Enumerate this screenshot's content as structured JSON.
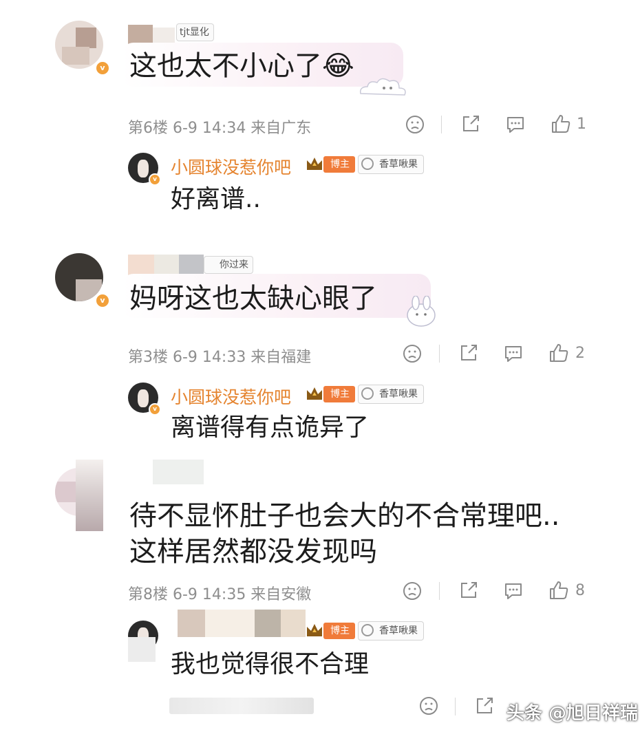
{
  "comments": [
    {
      "fan_badge": "tjt显化",
      "text": "这也太不小心了😂",
      "meta": "第6楼 6-9 14:34 来自广东",
      "likes": "1",
      "reply": {
        "name": "小圆球没惹你吧",
        "role": "博主",
        "tag": "香草啾果",
        "text": "好离谱.."
      }
    },
    {
      "fan_badge": "你过来",
      "text": "妈呀这也太缺心眼了",
      "meta": "第3楼 6-9 14:33 来自福建",
      "likes": "2",
      "reply": {
        "name": "小圆球没惹你吧",
        "role": "博主",
        "tag": "香草啾果",
        "text": "离谱得有点诡异了"
      }
    },
    {
      "text_line1": "待不显怀肚子也会大的不合常理吧..",
      "text_line2": "这样居然都没发现吗",
      "meta": "第8楼 6-9 14:35 来自安徽",
      "likes": "8",
      "reply": {
        "role": "博主",
        "tag": "香草啾果",
        "text": "我也觉得很不合理"
      }
    }
  ],
  "watermark": "头条 @旭日祥瑞",
  "icons": [
    "dislike-icon",
    "share-icon",
    "comment-icon",
    "like-icon"
  ],
  "colors": {
    "username": "#e5842f",
    "meta": "#8e8e8e",
    "bozhu_badge": "#f07b3a"
  }
}
